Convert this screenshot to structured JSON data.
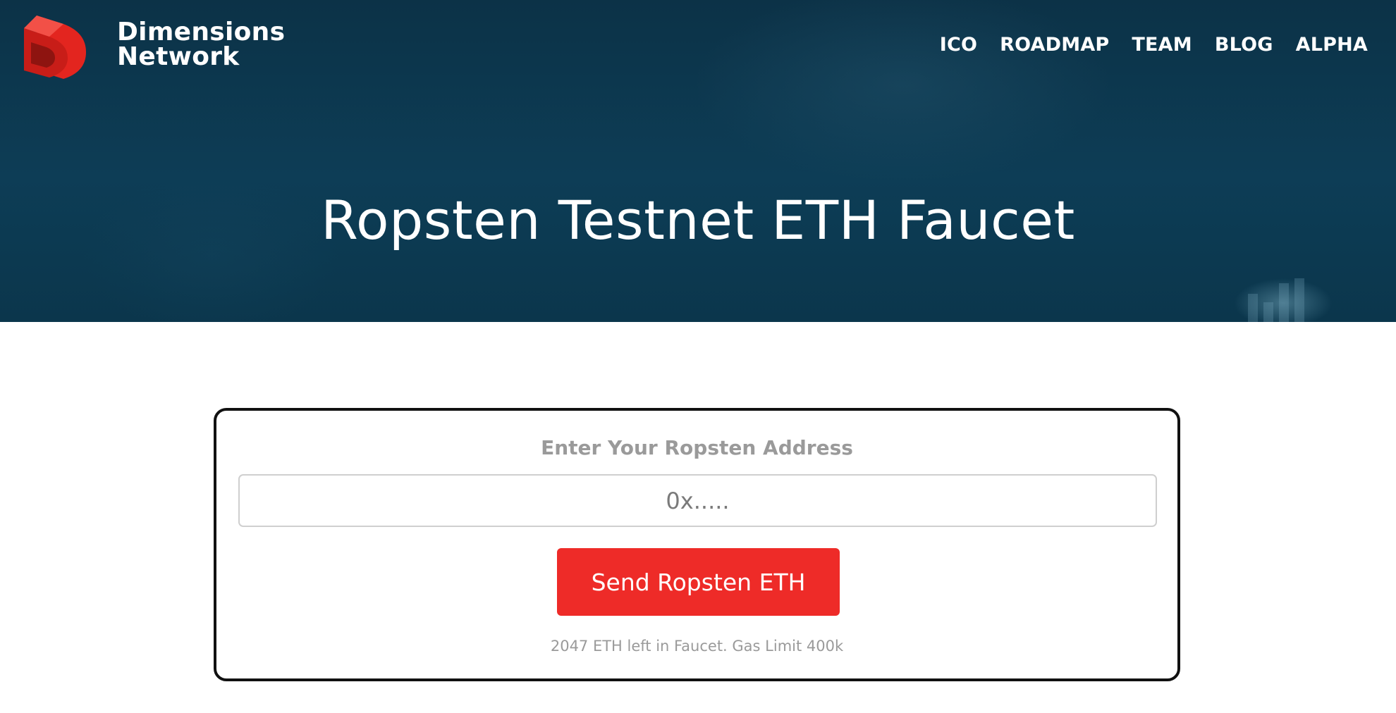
{
  "header": {
    "brand_line1": "Dimensions",
    "brand_line2": "Network",
    "nav": [
      {
        "label": "ICO"
      },
      {
        "label": "ROADMAP"
      },
      {
        "label": "TEAM"
      },
      {
        "label": "BLOG"
      },
      {
        "label": "ALPHA"
      }
    ],
    "logo_icon": "dimensions-logo-icon"
  },
  "hero": {
    "title": "Ropsten Testnet ETH Faucet"
  },
  "faucet": {
    "label": "Enter Your Ropsten Address",
    "address_placeholder": "0x.....",
    "address_value": "",
    "send_label": "Send Ropsten ETH",
    "status": "2047 ETH left in Faucet. Gas Limit 400k"
  },
  "colors": {
    "brand_red": "#ee2b28",
    "hero_bg": "#0d3d56",
    "muted_text": "#9a9a9a"
  }
}
